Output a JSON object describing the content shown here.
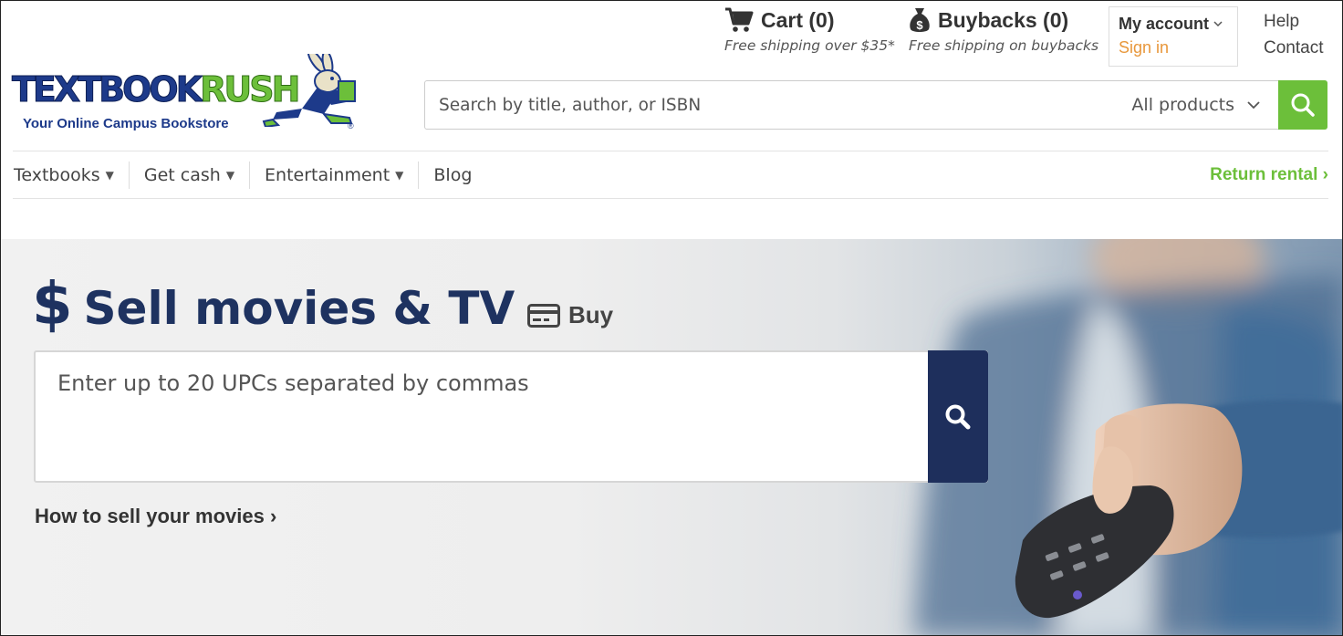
{
  "brand": {
    "logo_text_part1": "TEXTBOOK",
    "logo_text_part2": "RUSH",
    "tagline": "Your Online Campus Bookstore",
    "registered_mark": "®",
    "primary_color": "#1d3a8a",
    "accent_color": "#6cbf3a"
  },
  "header": {
    "cart": {
      "label": "Cart (0)",
      "note": "Free shipping over $35*",
      "icon": "cart-icon"
    },
    "buybacks": {
      "label": "Buybacks (0)",
      "note": "Free shipping on buybacks",
      "icon": "money-bag-icon"
    },
    "account": {
      "title": "My account",
      "sign_in": "Sign in",
      "sign_in_color": "#e8973b"
    },
    "help": "Help",
    "contact": "Contact"
  },
  "search": {
    "placeholder": "Search by title, author, or ISBN",
    "category": "All products",
    "button_icon": "search-icon"
  },
  "nav": {
    "items": [
      {
        "label": "Textbooks",
        "caret": "▼"
      },
      {
        "label": "Get cash",
        "caret": "▼"
      },
      {
        "label": "Entertainment",
        "caret": "▼"
      },
      {
        "label": "Blog"
      }
    ],
    "return_rental": "Return rental ›"
  },
  "hero": {
    "dollar": "$",
    "title": "Sell movies & TV",
    "buy_label": "Buy",
    "upc_placeholder": "Enter up to 20 UPCs separated by commas",
    "howto": "How to sell your movies ›",
    "button_color": "#1e2f5c",
    "title_color": "#1e3260"
  }
}
